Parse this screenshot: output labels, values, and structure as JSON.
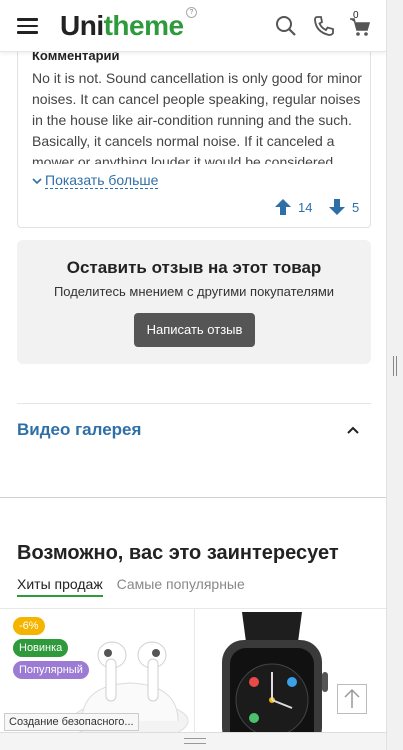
{
  "header": {
    "logo_part1": "Uni",
    "logo_part2": "theme",
    "logo_badge": "?",
    "cart_count": "0",
    "icons": [
      "menu-icon",
      "search-icon",
      "phone-icon",
      "cart-icon"
    ]
  },
  "review": {
    "label": "Комментарий",
    "text": "No it is not. Sound cancellation is only good for minor noises. It can cancel people speaking, regular noises in the house like air-condition running and the such. Basically, it cancels normal noise. If it canceled a mower or anything louder it would be considered...",
    "show_more": "Показать больше",
    "likes": "14",
    "dislikes": "5"
  },
  "leave_review": {
    "title": "Оставить отзыв на этот товар",
    "subtitle": "Поделитесь мнением с другими покупателями",
    "button": "Написать отзыв"
  },
  "video": {
    "title": "Видео галерея"
  },
  "recommendations": {
    "title": "Возможно, вас это заинтересует",
    "tabs": [
      {
        "label": "Хиты продаж",
        "active": true
      },
      {
        "label": "Самые популярные",
        "active": false
      }
    ],
    "product1_badges": [
      "-6%",
      "Новинка",
      "Популярный"
    ]
  },
  "status": {
    "text": "Создание безопасного..."
  },
  "colors": {
    "brand_green": "#2e9a3c",
    "link_blue": "#2f6fa8",
    "button_dark": "#555555"
  }
}
